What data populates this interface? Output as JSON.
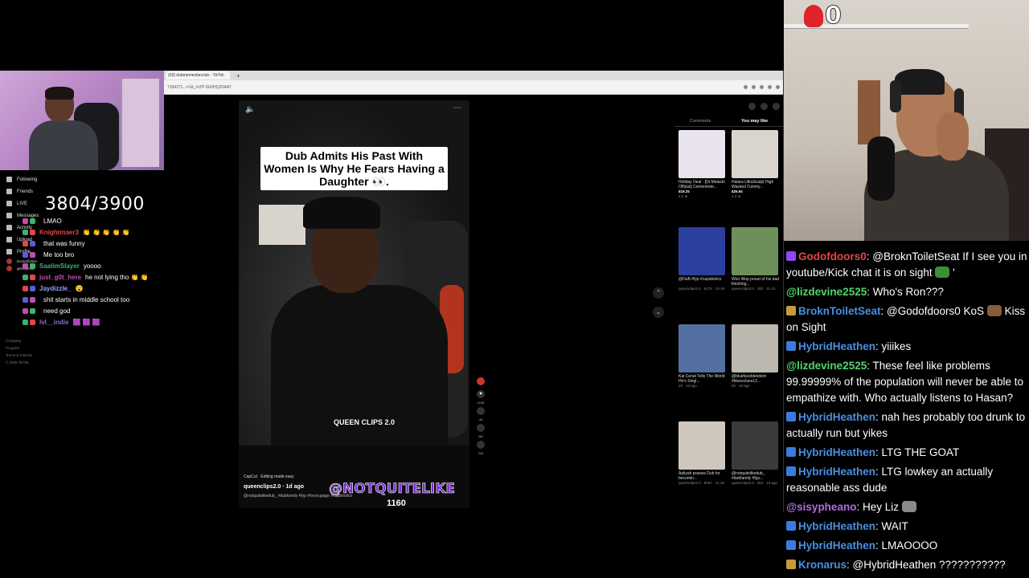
{
  "browser": {
    "tab_label": "(69) dubmemesfanclub - TikTok",
    "url": "7184271...=1&_t=ZP-9U0HQ2N4AT",
    "new_tab": "+"
  },
  "tiktok_nav": {
    "items": [
      {
        "label": "Following",
        "icon": "following-icon"
      },
      {
        "label": "Friends",
        "icon": "friends-icon"
      },
      {
        "label": "LIVE",
        "icon": "live-icon"
      },
      {
        "label": "Messages",
        "icon": "messages-icon"
      },
      {
        "label": "Activity",
        "icon": "activity-icon"
      },
      {
        "label": "Upload",
        "icon": "upload-icon"
      },
      {
        "label": "Profile",
        "icon": "profile-icon"
      }
    ],
    "following_accounts": [
      "Doctorfiction",
      "genksfictie"
    ],
    "footer": [
      "Company",
      "Program",
      "Terms & Policies",
      "© 2025 TikTok"
    ]
  },
  "goal_counter": "3804/3900",
  "overlay_chat": [
    {
      "name": "",
      "color": "#5b5bd6",
      "msg": "LMAO"
    },
    {
      "name": "Knightmaer3",
      "color": "#e04848",
      "msg": "👏 👏 👏 👏 👏"
    },
    {
      "name": "",
      "color": "#c04db0",
      "msg": "that was funny"
    },
    {
      "name": "",
      "color": "#c04db0",
      "msg": "Me too bro"
    },
    {
      "name": "SaalimSlayer",
      "color": "#3cb371",
      "msg": "yoooo"
    },
    {
      "name": "just_g0t_here",
      "color": "#c04db0",
      "msg": "he not lying tho 👏 👏"
    },
    {
      "name": "Jaydizzle_",
      "color": "#9aa0ff",
      "msg": "😮"
    },
    {
      "name": "",
      "color": "#5b5bd6",
      "msg": "shit starts in middle school too"
    },
    {
      "name": "",
      "color": "#e04848",
      "msg": "need god"
    },
    {
      "name": "lvl__indie",
      "color": "#8e6bd6",
      "msg": "🟪 🟪 🟪"
    }
  ],
  "video": {
    "caption": "Dub Admits His Past With Women Is Why He Fears Having a Daughter 👀.",
    "watermark": "QUEEN CLIPS 2.0",
    "capcut": "CapCut · Editing made easy",
    "author": "queenclips2.0 · 1d ago",
    "description": "@notquitelikedub_ #dubfamily #fyp #foryoupage #capaholics",
    "handle": "@NOTQUITELIKE",
    "handle_num": "1160",
    "actions": [
      {
        "icon": "avatar-icon",
        "count": ""
      },
      {
        "icon": "heart-icon",
        "count": "4168"
      },
      {
        "icon": "comment-icon",
        "count": "48"
      },
      {
        "icon": "bookmark-icon",
        "count": "382"
      },
      {
        "icon": "share-icon",
        "count": "349"
      }
    ]
  },
  "recommendations": {
    "tabs": [
      "Comments",
      "You may like"
    ],
    "active_tab": "You may like",
    "cards": [
      {
        "title": "Holiday Deal · [Dr.Melaxin Official] Cementrete...",
        "sub": "4.2 ★",
        "price": "$19.25",
        "color": "#e9e3ef"
      },
      {
        "title": "Halara UltraSculpt High Waisted Tummy...",
        "sub": "4.4 ★",
        "price": "$26.94",
        "color": "#d9d4ce"
      },
      {
        "title": "@DuB #fyp #capaholics",
        "sub": "queenclips2.0 · 6179 · 12-19",
        "price": "",
        "color": "#2a3f9e"
      },
      {
        "title": "Woo Wop proud of his dad finishing...",
        "sub": "queenclips2.0 · 282 · 11-15",
        "price": "",
        "color": "#6f8f5a"
      },
      {
        "title": "Kai Cenat Tells The World He's Singl...",
        "sub": "25 · 1d ago",
        "price": "",
        "color": "#5470a0"
      },
      {
        "title": "@bluefacebleedem #bluesclues12...",
        "sub": "82 · 4d ago",
        "price": "",
        "color": "#bcb8b0"
      },
      {
        "title": "Aaliyah praises Dub for becomin...",
        "sub": "queenclips2.0 · 8097 · 11-26",
        "price": "",
        "color": "#cfc7be"
      },
      {
        "title": "@notquitelikedub_ #dubfamily #fyp...",
        "sub": "queenclips2.0 · 204 · 1d ago",
        "price": "",
        "color": "#3a3a3a"
      }
    ]
  },
  "sub_count": "0",
  "chat": [
    {
      "badge": "#9146ff",
      "name": "Godofdoors0",
      "color": "#e04848",
      "text": ": @BroknToiletSeat If I see you in youtube/Kick chat it is on sight",
      "emote": "#3a8f3a",
      "after": "'"
    },
    {
      "badge": "",
      "name": "@lizdevine2525",
      "color": "#4fd86a",
      "text": ": Who's Ron???",
      "emote": "",
      "after": ""
    },
    {
      "badge": "#c89a3a",
      "name": "BroknToiletSeat",
      "color": "#4a8fe0",
      "text": ": @Godofdoors0 KoS",
      "emote": "#8a5a3a",
      "after": "Kiss on Sight"
    },
    {
      "badge": "#3a7be0",
      "name": "HybridHeathen",
      "color": "#4a8fe0",
      "text": ": yiiikes",
      "emote": "",
      "after": ""
    },
    {
      "badge": "",
      "name": "@lizdevine2525",
      "color": "#4fd86a",
      "text": ": These feel like problems 99.99999% of the population will never be able to empathize with. Who actually listens to Hasan?",
      "emote": "",
      "after": ""
    },
    {
      "badge": "#3a7be0",
      "name": "HybridHeathen",
      "color": "#4a8fe0",
      "text": ": nah hes probably too drunk to actually run but yikes",
      "emote": "",
      "after": ""
    },
    {
      "badge": "#3a7be0",
      "name": "HybridHeathen",
      "color": "#4a8fe0",
      "text": ": LTG THE GOAT",
      "emote": "",
      "after": ""
    },
    {
      "badge": "#3a7be0",
      "name": "HybridHeathen",
      "color": "#4a8fe0",
      "text": ": LTG lowkey an actually reasonable ass dude",
      "emote": "",
      "after": ""
    },
    {
      "badge": "",
      "name": "@sisypheano",
      "color": "#b06be0",
      "text": ": Hey Liz",
      "emote": "#8a8a8a",
      "after": ""
    },
    {
      "badge": "#3a7be0",
      "name": "HybridHeathen",
      "color": "#4a8fe0",
      "text": ": WAIT",
      "emote": "",
      "after": ""
    },
    {
      "badge": "#3a7be0",
      "name": "HybridHeathen",
      "color": "#4a8fe0",
      "text": ": LMAOOOO",
      "emote": "",
      "after": ""
    },
    {
      "badge": "#c89a3a",
      "name": "Kronarus",
      "color": "#4a8fe0",
      "text": ": @HybridHeathen ???????????",
      "emote": "",
      "after": ""
    }
  ]
}
